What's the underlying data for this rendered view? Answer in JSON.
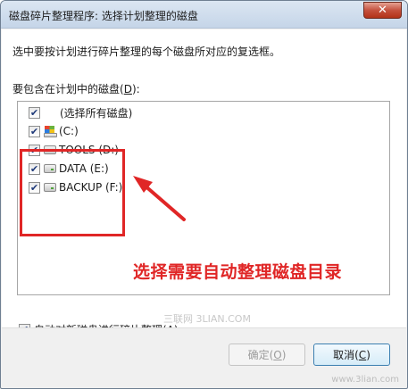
{
  "window": {
    "title": "磁盘碎片整理程序: 选择计划整理的磁盘",
    "close_glyph": "✕"
  },
  "content": {
    "instruction": "选中要按计划进行碎片整理的每个磁盘所对应的复选框。",
    "list_label": "要包含在计划中的磁盘(",
    "list_label_hotkey": "D",
    "list_label_suffix": "):",
    "items": [
      {
        "label": "(选择所有磁盘)",
        "checked": true,
        "icon": "none"
      },
      {
        "label": "(C:)",
        "checked": true,
        "icon": "windows-drive-icon"
      },
      {
        "label": "TOOLS (D:)",
        "checked": true,
        "icon": "drive-icon"
      },
      {
        "label": "DATA (E:)",
        "checked": true,
        "icon": "drive-icon"
      },
      {
        "label": "BACKUP (F:)",
        "checked": true,
        "icon": "drive-icon"
      }
    ]
  },
  "annotation": {
    "text": "选择需要自动整理磁盘目录",
    "color": "#e02626"
  },
  "auto_option": {
    "label": "自动对新磁盘进行碎片整理(",
    "hotkey": "A",
    "suffix": ")",
    "checked": true
  },
  "buttons": {
    "ok_label": "确定(",
    "ok_hotkey": "O",
    "ok_suffix": ")",
    "cancel_label": "取消(",
    "cancel_hotkey": "C",
    "cancel_suffix": ")"
  },
  "watermarks": {
    "center": "三联网 3LIAN.COM",
    "bottom_right": "www.3lian.com"
  },
  "check_glyph": "✔"
}
